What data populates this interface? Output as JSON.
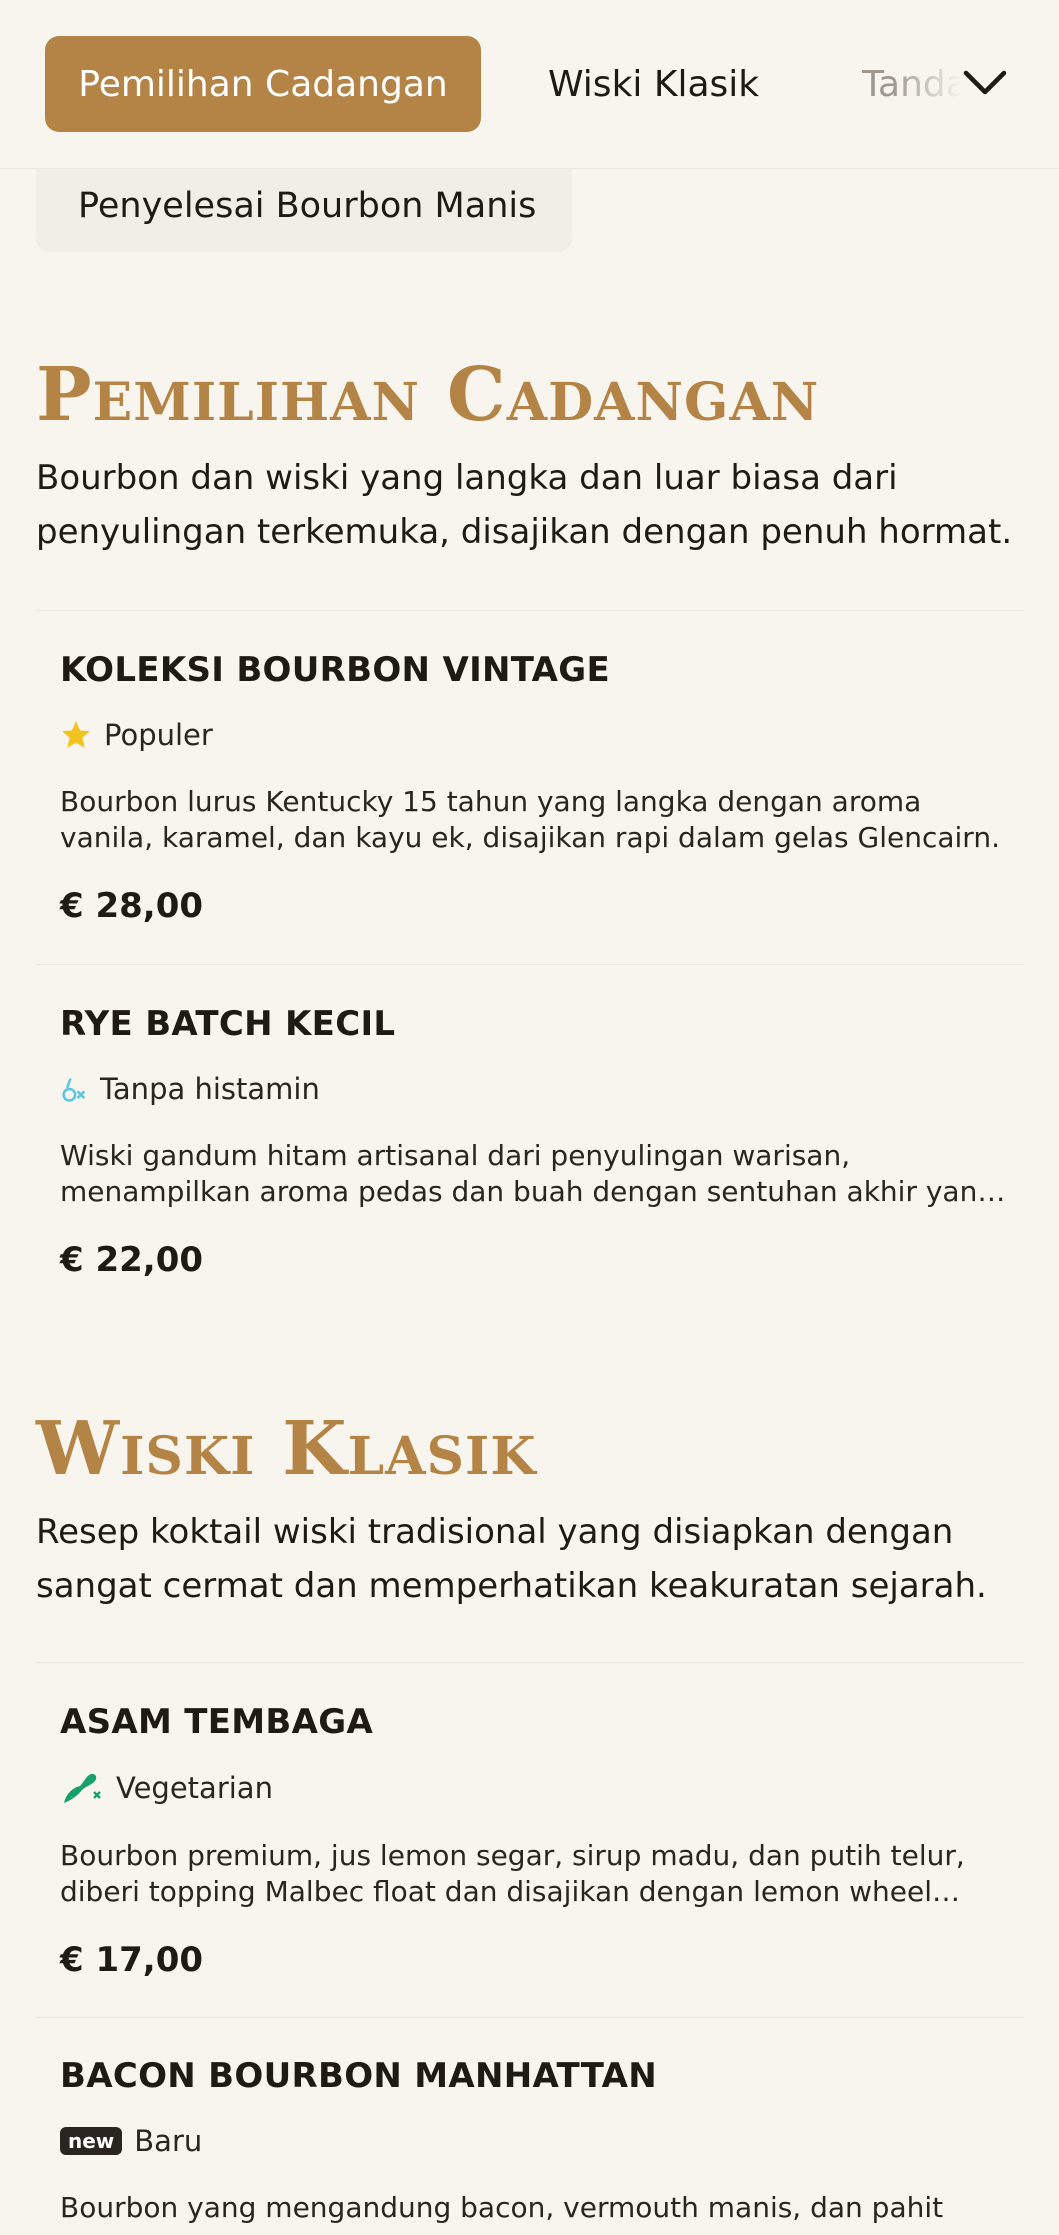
{
  "nav": {
    "tabs": [
      "Pemilihan Cadangan",
      "Wiski Klasik",
      "Tanda Tangan"
    ],
    "active_color": "#b38445"
  },
  "subchip": "Penyelesai Bourbon Manis",
  "sections": [
    {
      "title": "Pemilihan Cadangan",
      "description": "Bourbon dan wiski yang langka dan luar biasa dari penyulingan terkemuka, disajikan dengan penuh hormat.",
      "items": [
        {
          "name": "KOLEKSI BOURBON VINTAGE",
          "tag": "Populer",
          "tag_icon": "star-icon",
          "description": "Bourbon lurus Kentucky 15 tahun yang langka dengan aroma vanila, karamel, dan kayu ek, disajikan rapi dalam gelas Glencairn.",
          "price": "€ 28,00"
        },
        {
          "name": "RYE BATCH KECIL",
          "tag": "Tanpa histamin",
          "tag_icon": "histamine-free-icon",
          "description": "Wiski gandum hitam artisanal dari penyulingan warisan, menampilkan aroma pedas dan buah dengan sentuhan akhir yang halus.",
          "price": "€ 22,00"
        }
      ]
    },
    {
      "title": "Wiski Klasik",
      "description": "Resep koktail wiski tradisional yang disiapkan dengan sangat cermat dan memperhatikan keakuratan sejarah.",
      "items": [
        {
          "name": "ASAM TEMBAGA",
          "tag": "Vegetarian",
          "tag_icon": "vegetarian-icon",
          "description": "Bourbon premium, jus lemon segar, sirup madu, dan putih telur, diberi topping Malbec float dan disajikan dengan lemon wheel segar.",
          "price": "€ 17,00"
        },
        {
          "name": "BACON BOURBON MANHATTAN",
          "tag": "Baru",
          "tag_badge": "new",
          "tag_icon": "new-badge-icon",
          "description": "Bourbon yang mengandung bacon, vermouth manis, dan pahit",
          "price": ""
        }
      ]
    }
  ]
}
